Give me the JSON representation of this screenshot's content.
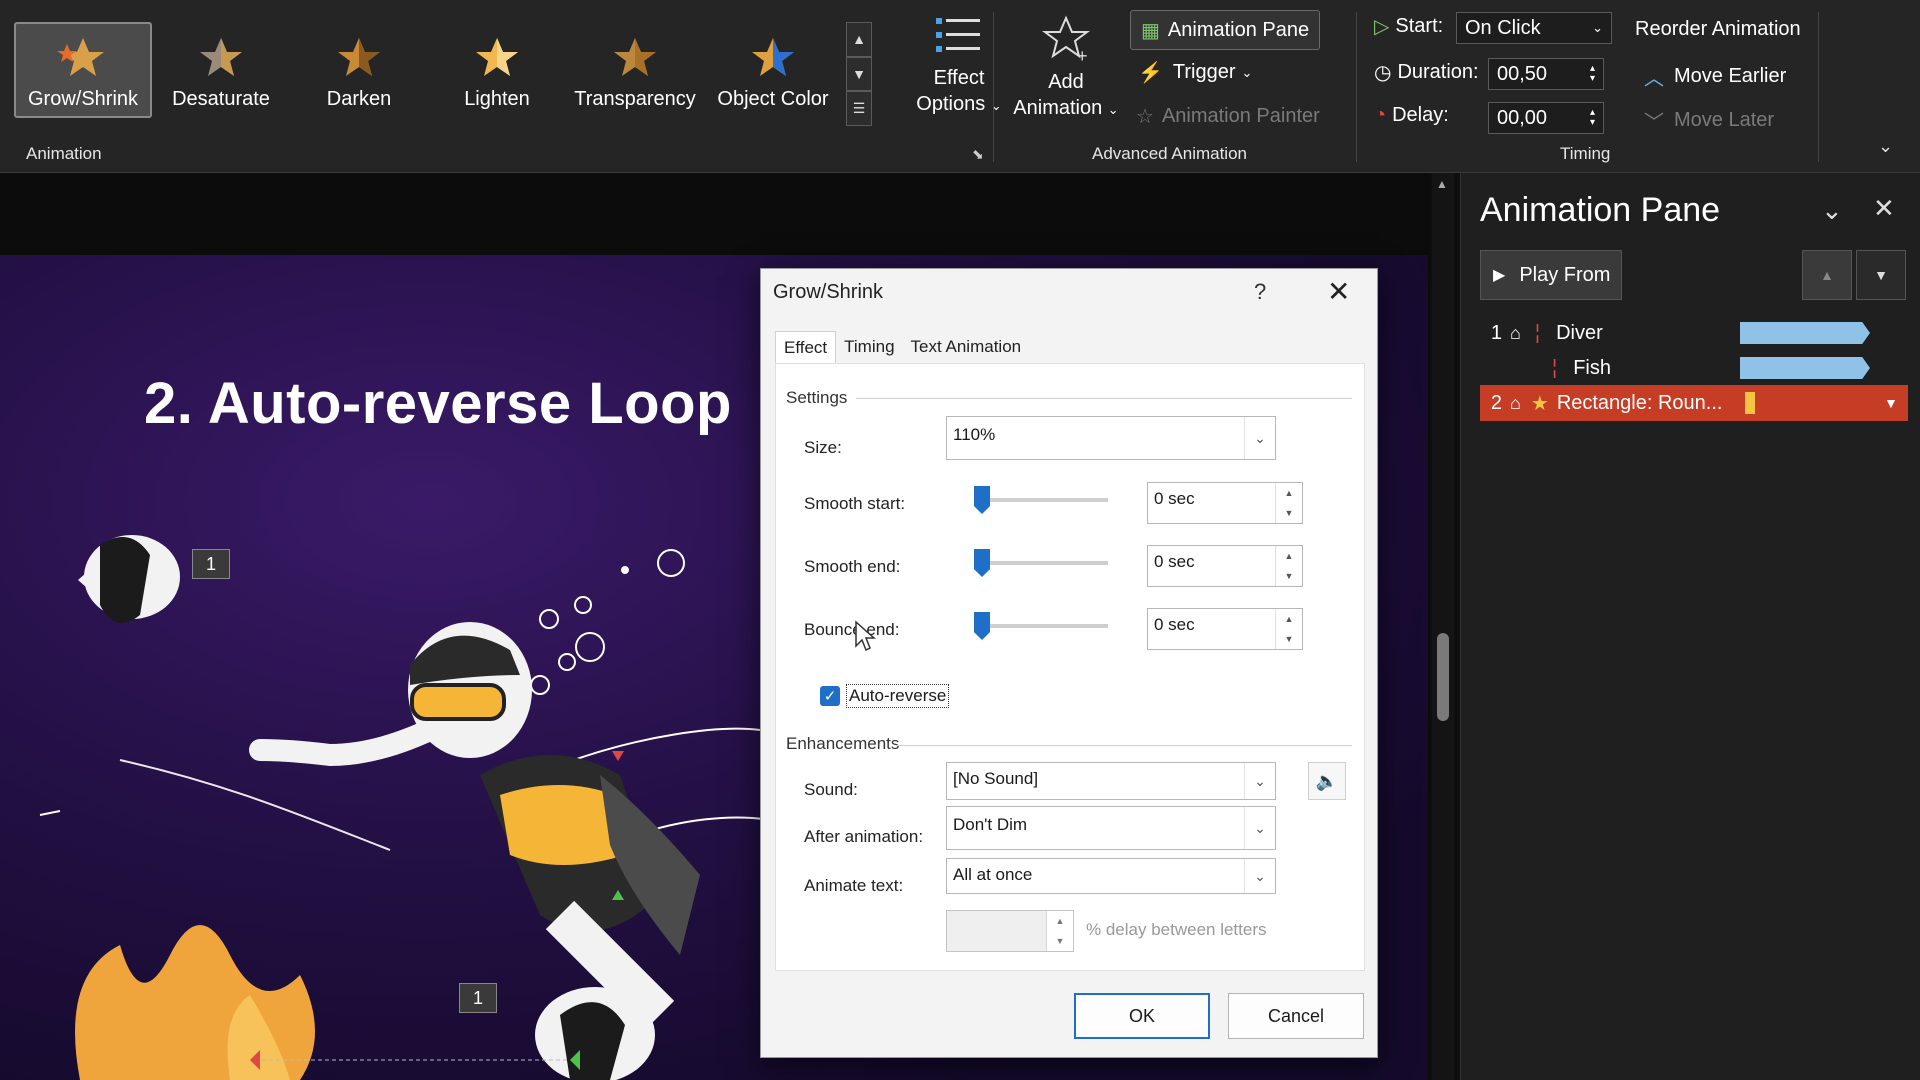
{
  "ribbon": {
    "gallery": [
      {
        "label": "Grow/Shrink",
        "icon": "star-grow-icon",
        "selected": true
      },
      {
        "label": "Desaturate",
        "icon": "star-desaturate-icon"
      },
      {
        "label": "Darken",
        "icon": "star-darken-icon"
      },
      {
        "label": "Lighten",
        "icon": "star-lighten-icon"
      },
      {
        "label": "Transparency",
        "icon": "star-transparency-icon"
      },
      {
        "label": "Object Color",
        "icon": "star-color-icon"
      }
    ],
    "effect_options_line1": "Effect",
    "effect_options_line2": "Options",
    "animation_group": "Animation",
    "add_animation_line1": "Add",
    "add_animation_line2": "Animation",
    "animation_pane_btn": "Animation Pane",
    "trigger": "Trigger",
    "animation_painter": "Animation Painter",
    "advanced_group": "Advanced Animation",
    "start_label": "Start:",
    "start_value": "On Click",
    "duration_label": "Duration:",
    "duration_value": "00,50",
    "delay_label": "Delay:",
    "delay_value": "00,00",
    "timing_group": "Timing",
    "reorder": "Reorder Animation",
    "move_earlier": "Move Earlier",
    "move_later": "Move Later"
  },
  "slide": {
    "title": "2. Auto-reverse Loop",
    "tags": [
      "1",
      "1"
    ]
  },
  "pane": {
    "title": "Animation Pane",
    "play_from": "Play From",
    "items": [
      {
        "num": "1",
        "name": "Diver"
      },
      {
        "num": "",
        "name": "Fish"
      },
      {
        "num": "2",
        "name": "Rectangle: Roun..."
      }
    ]
  },
  "dialog": {
    "title": "Grow/Shrink",
    "help": "?",
    "tabs": [
      "Effect",
      "Timing",
      "Text Animation"
    ],
    "settings_header": "Settings",
    "size_label": "Size:",
    "size_value": "110%",
    "smooth_start_label": "Smooth start:",
    "smooth_start_value": "0 sec",
    "smooth_end_label": "Smooth end:",
    "smooth_end_value": "0 sec",
    "bounce_end_label": "Bounce end:",
    "bounce_end_value": "0 sec",
    "auto_reverse_label": "Auto-reverse",
    "auto_reverse_checked": true,
    "enhancements_header": "Enhancements",
    "sound_label": "Sound:",
    "sound_value": "[No Sound]",
    "after_label": "After animation:",
    "after_value": "Don't Dim",
    "animate_text_label": "Animate text:",
    "animate_text_value": "All at once",
    "delay_letters_label": "% delay between letters",
    "ok": "OK",
    "cancel": "Cancel"
  },
  "colors": {
    "accent": "#1f6fc9",
    "selected_row": "#c53d25",
    "timeline_bar": "#8fc2e6"
  }
}
